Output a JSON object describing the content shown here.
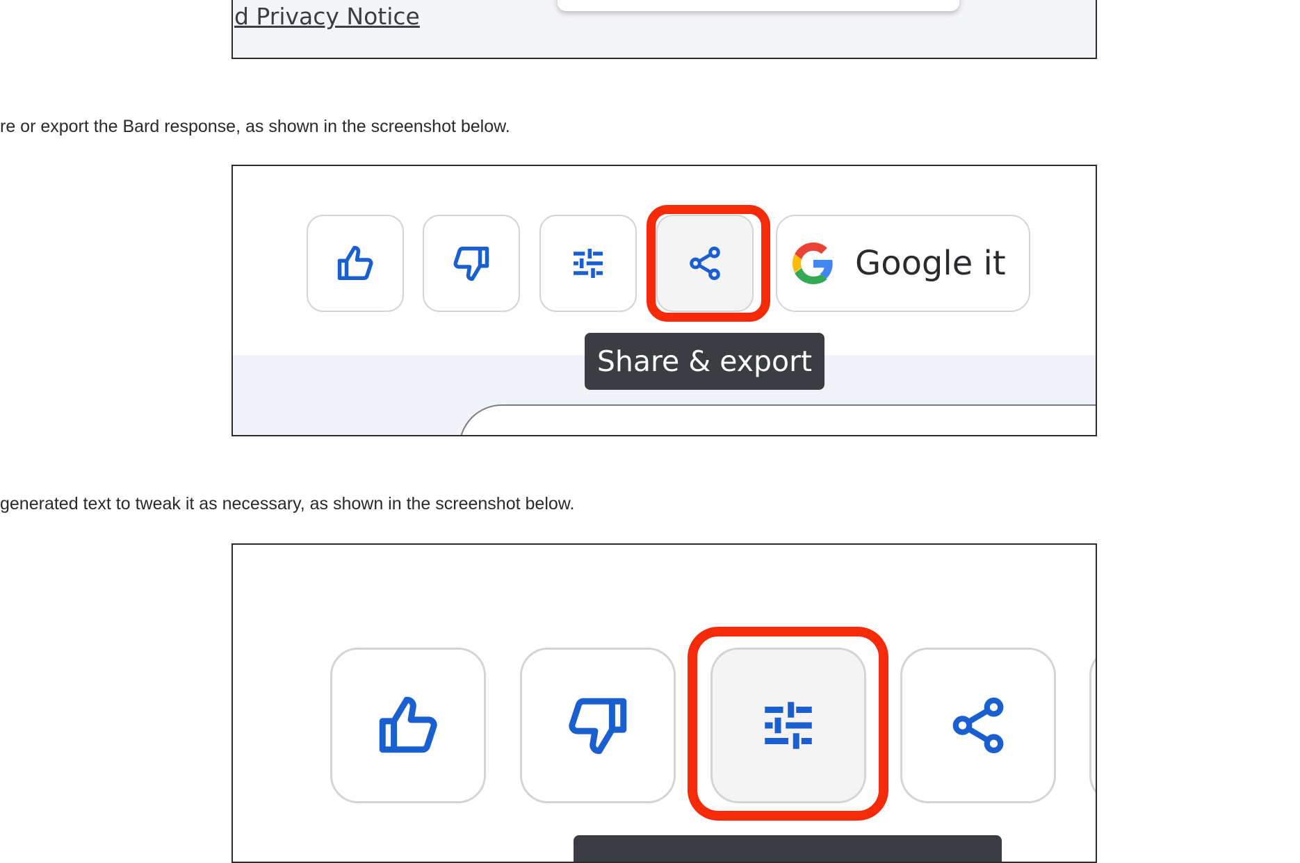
{
  "top": {
    "link_text": "d Privacy Notice"
  },
  "paragraphs": [
    "re or export the Bard response, as shown in the screenshot below.",
    "generated text to tweak it as necessary, as shown in the screenshot below."
  ],
  "screenshot1": {
    "buttons": [
      "thumbs-up",
      "thumbs-down",
      "modify-response",
      "share",
      "google-it"
    ],
    "google_label": "Google it",
    "tooltip": "Share & export",
    "highlighted": "share"
  },
  "screenshot2": {
    "buttons": [
      "thumbs-up",
      "thumbs-down",
      "modify-response",
      "share"
    ],
    "highlighted": "modify-response"
  },
  "colors": {
    "icon_blue": "#1a5fd0",
    "highlight_red": "#f42a08",
    "tooltip_bg": "#3a3d41",
    "panel_gray": "#f2f3f8",
    "google_blue": "#4285F4",
    "google_red": "#EA4335",
    "google_yellow": "#FBBC05",
    "google_green": "#34A853"
  }
}
